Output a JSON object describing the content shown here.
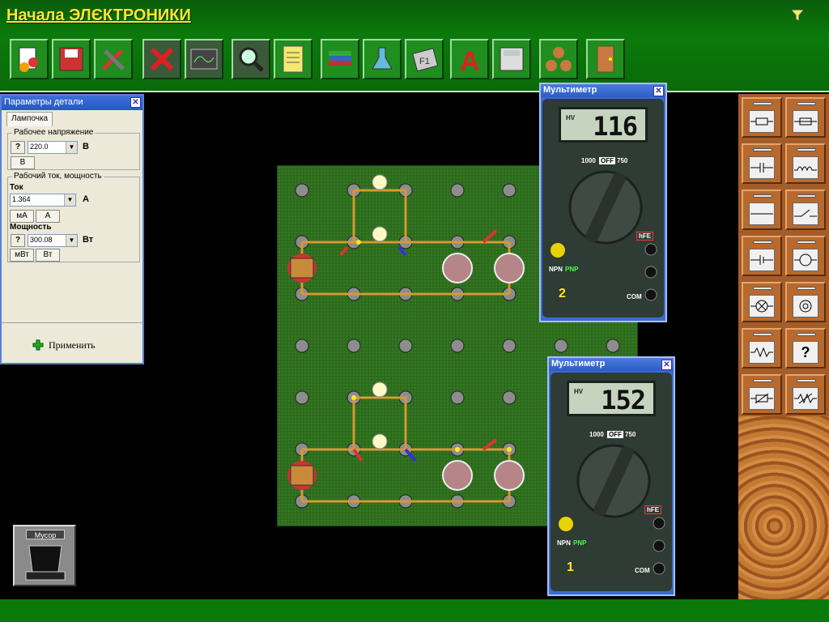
{
  "app": {
    "title": "Начала ЭЛЄКТРОНИКИ"
  },
  "toolbar": {
    "buttons": [
      "save",
      "load",
      "tools",
      "delete",
      "oscilloscope",
      "magnifier",
      "notes",
      "books",
      "chemistry",
      "help-f1",
      "font",
      "calculator",
      "molecule",
      "exit"
    ]
  },
  "params_panel": {
    "title": "Параметры детали",
    "tab": "Лампочка",
    "voltage_group": "Рабочее напряжение",
    "voltage_q": "?",
    "voltage_value": "220.0",
    "voltage_unit": "В",
    "voltage_unit_btn": "В",
    "current_group": "Рабочий ток, мощность",
    "current_label": "Ток",
    "current_value": "1.364",
    "current_unit": "А",
    "current_btn_ma": "мА",
    "current_btn_a": "А",
    "power_label": "Мощность",
    "power_q": "?",
    "power_value": "300.08",
    "power_unit": "Вт",
    "power_btn_mw": "мВт",
    "power_btn_w": "Вт",
    "apply_label": "Применить"
  },
  "meter_top": {
    "title": "Мультиметр",
    "display": "116",
    "hv": "HV",
    "number": "2"
  },
  "meter_bottom": {
    "title": "Мультиметр",
    "display": "152",
    "hv": "HV",
    "number": "1"
  },
  "meter_labels": {
    "off": "OFF",
    "r1000": "1000",
    "r750": "750",
    "hfe": "hFE",
    "npn": "NPN",
    "pnp": "PNP",
    "com": "COM"
  },
  "parts_panel": {
    "drawers": [
      "resistor",
      "fuse",
      "capacitor",
      "inductor",
      "wire",
      "switch",
      "polar-capacitor",
      "ammeter",
      "lamp",
      "coil",
      "resistor-zigzag",
      "unknown",
      "variable-resistor",
      "variable-resistor-2"
    ],
    "unknown_symbol": "?"
  },
  "trash": {
    "label": "Мусор"
  },
  "colors": {
    "accent": "#ffe62a",
    "green": "#0b7a0b",
    "board": "#2d6b1e"
  }
}
